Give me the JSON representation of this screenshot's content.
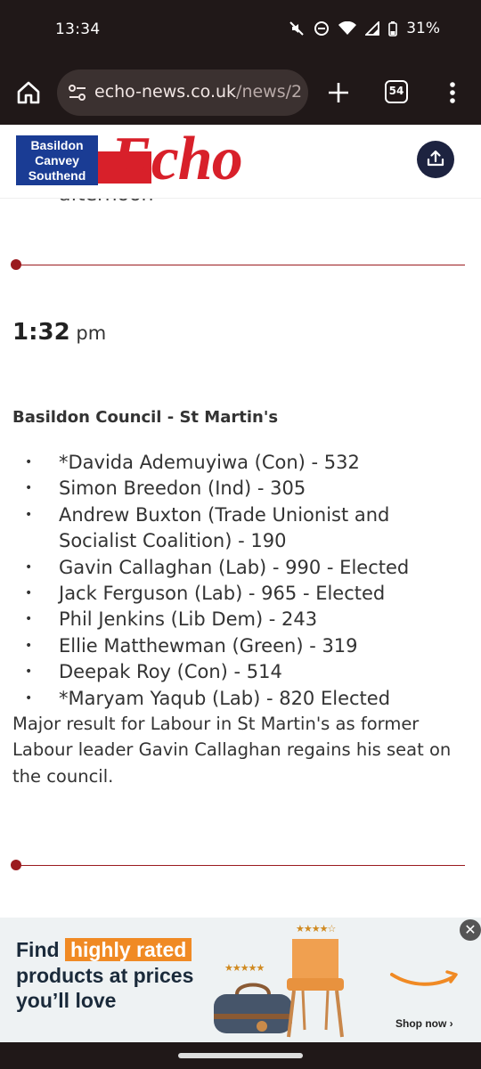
{
  "status_bar": {
    "time": "13:34",
    "battery": "31%",
    "icons": [
      "mute-icon",
      "dnd-icon",
      "wifi-icon",
      "signal-icon",
      "battery-icon"
    ]
  },
  "browser": {
    "url_domain": "echo-news.co.uk",
    "url_path": "/news/2",
    "tab_count": "54"
  },
  "site": {
    "logo_lines": [
      "Basildon",
      "Canvey",
      "Southend"
    ],
    "logo_word": "Echo",
    "accent_color": "#9b1b1f",
    "brand_red": "#d8202a",
    "brand_blue": "#1a3c94"
  },
  "article": {
    "partial_text": "afternoon",
    "time": "1:32",
    "time_suffix": "pm",
    "heading": "Basildon Council - St Martin's",
    "results": [
      "*Davida Ademuyiwa (Con) - 532",
      "Simon Breedon (Ind) - 305",
      "Andrew Buxton (Trade Unionist and Socialist Coalition) - 190",
      "Gavin Callaghan (Lab) - 990 - Elected",
      "Jack Ferguson (Lab) - 965 - Elected",
      "Phil Jenkins (Lib Dem) - 243",
      "Ellie Matthewman (Green) - 319",
      "Deepak Roy (Con) - 514",
      "*Maryam Yaqub (Lab) - 820 Elected"
    ],
    "summary": "Major result for Labour in St Martin's as former Labour leader Gavin Callaghan regains his seat on the council."
  },
  "ad": {
    "line1_a": "Find",
    "line1_b": "highly rated",
    "line2": "products at prices",
    "line3": "you’ll love",
    "cta": "Shop now ›"
  }
}
